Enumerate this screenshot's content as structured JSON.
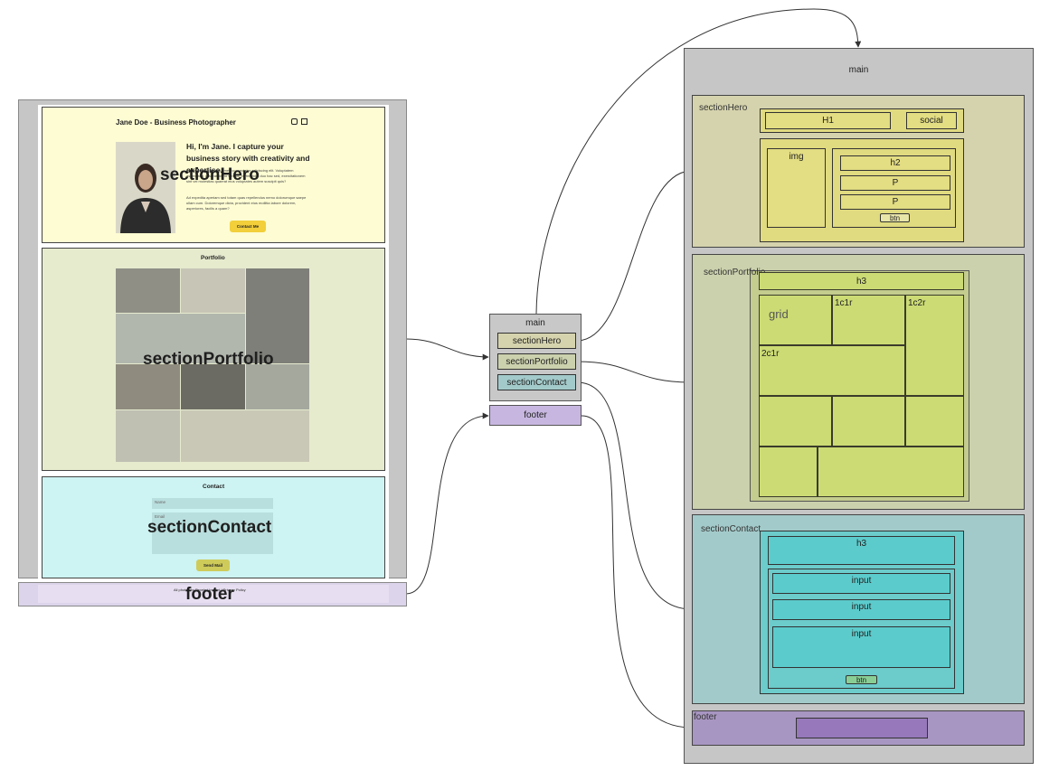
{
  "left_mock": {
    "hero": {
      "site_title": "Jane Doe - Business Photographer",
      "heading": "Hi, I'm Jane. I capture your business story with creativity and expertise.",
      "para1": "Lorem ipsum dolor sit amet, consectetur adipiscing elit. Voluptatem aspernatur, placeat nemo veniam perferendis duo hac sed, exercitationem sint vel molestias quaerat eius voluptates autem suscipit quis?",
      "para2": "Ad expedita aperiam sed totam quas repellendus nemo dolorumque saepe ullam cum. Doloremque dicta, provident eius mollitia labore dolorem, asperiores, facilis a quam?",
      "contact_button": "Contact Me",
      "overlay_label": "sectionHero",
      "social_icons": [
        "instagram-icon",
        "linkedin-icon"
      ]
    },
    "portfolio": {
      "heading": "Portfolio",
      "overlay_label": "sectionPortfolio"
    },
    "contact": {
      "heading": "Contact",
      "name_placeholder": "Name",
      "email_placeholder": "Email",
      "send_button": "Send Mail",
      "overlay_label": "sectionContact"
    },
    "footer": {
      "text": "All photos by Pexels | Imprint | Privacy Policy",
      "overlay_label": "footer"
    }
  },
  "middle": {
    "title": "main",
    "items": [
      "sectionHero",
      "sectionPortfolio",
      "sectionContact"
    ],
    "footer": "footer"
  },
  "right": {
    "main_label": "main",
    "hero": {
      "label": "sectionHero",
      "h1": "H1",
      "social": "social",
      "img": "img",
      "h2": "h2",
      "p1": "P",
      "p2": "P",
      "btn": "btn"
    },
    "portfolio": {
      "label": "sectionPortfolio",
      "h3": "h3",
      "grid": "grid",
      "c1": "1c1r",
      "c2": "1c2r",
      "c3": "2c1r"
    },
    "contact": {
      "label": "sectionContact",
      "h3": "h3",
      "inputs": [
        "input",
        "input",
        "input"
      ],
      "btn": "btn"
    },
    "footer": {
      "label": "footer"
    }
  },
  "colors": {
    "hero": "#fdfcd3",
    "portfolio": "#e6ebce",
    "contact": "#cdf3f2",
    "footer": "#dcd4ea",
    "gold_button": "#f2cf3b",
    "olive_button": "#cfcb5a"
  }
}
